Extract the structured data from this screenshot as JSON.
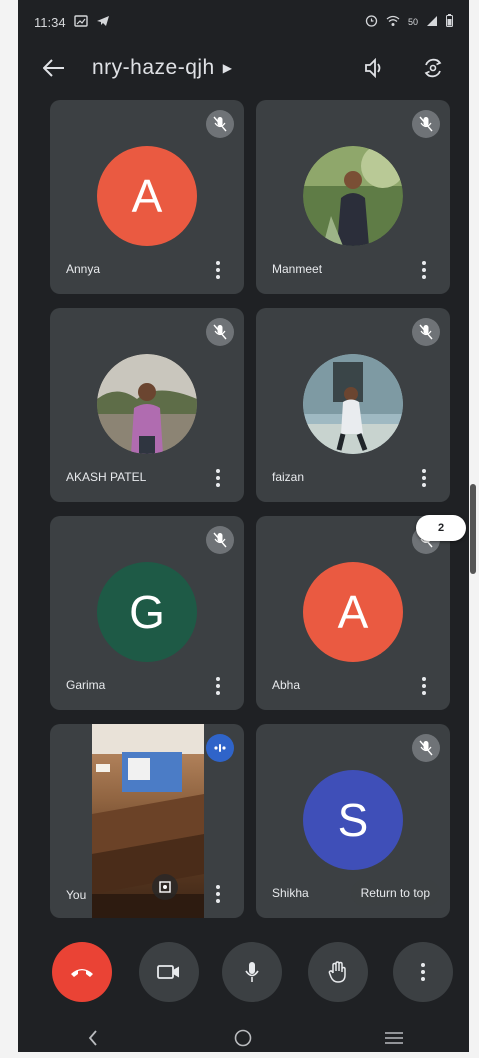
{
  "status_bar": {
    "time": "11:34",
    "battery_text": "50"
  },
  "header": {
    "meeting_code": "nry-haze-qjh"
  },
  "participants": [
    {
      "name": "Annya",
      "initial": "A",
      "color": "#ea5a41",
      "type": "initial",
      "muted": true
    },
    {
      "name": "Manmeet",
      "initial": "",
      "color": "#4d6a3c",
      "type": "photo",
      "muted": true
    },
    {
      "name": "AKASH PATEL",
      "initial": "",
      "color": "#7c6b5c",
      "type": "photo",
      "muted": true
    },
    {
      "name": "faizan",
      "initial": "",
      "color": "#8faab5",
      "type": "photo",
      "muted": true
    },
    {
      "name": "Garima",
      "initial": "G",
      "color": "#1e5a46",
      "type": "initial",
      "muted": true
    },
    {
      "name": "Abha",
      "initial": "A",
      "color": "#ea5a41",
      "type": "initial",
      "muted": true
    },
    {
      "name": "You",
      "initial": "",
      "color": "#8f6340",
      "type": "self",
      "muted": false
    },
    {
      "name": "Shikha",
      "initial": "S",
      "color": "#3f4fb8",
      "type": "initial",
      "muted": true
    }
  ],
  "hidden_count": "2",
  "return_to_top": "Return to top",
  "controls": [
    "end-call",
    "camera",
    "microphone",
    "raise-hand",
    "more-options"
  ],
  "colors": {
    "end_call": "#ea4335",
    "tile_bg": "#3c4043",
    "page_bg": "#1f2124",
    "speaking": "#3b6fd6"
  }
}
